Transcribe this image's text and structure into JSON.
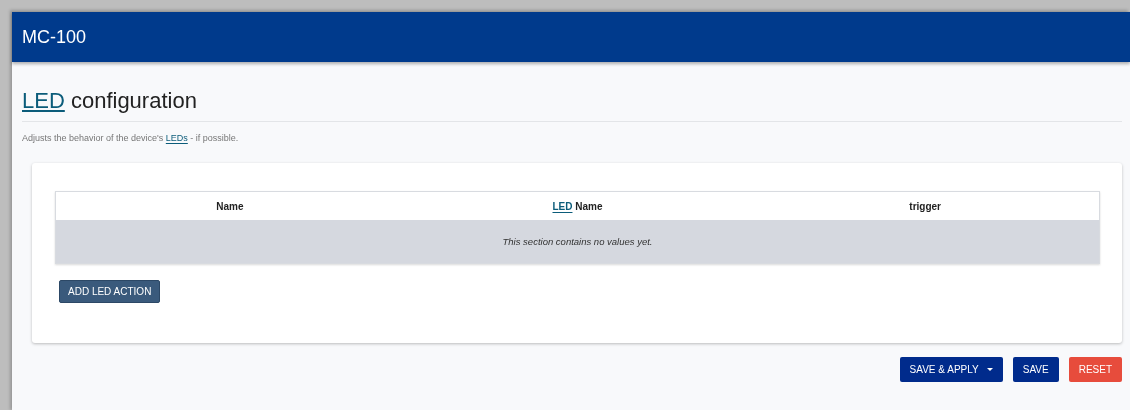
{
  "header": {
    "title": "MC-100"
  },
  "page": {
    "heading": [
      {
        "kind": "abbr",
        "text": "LED"
      },
      {
        "kind": "text",
        "text": " configuration"
      }
    ],
    "description": [
      {
        "kind": "text",
        "text": "Adjusts the behavior of the device's "
      },
      {
        "kind": "abbr",
        "text": "LEDs"
      },
      {
        "kind": "text",
        "text": " - if possible."
      }
    ]
  },
  "table": {
    "columns": [
      [
        {
          "kind": "text",
          "text": "Name"
        }
      ],
      [
        {
          "kind": "abbr",
          "text": "LED"
        },
        {
          "kind": "text",
          "text": " Name"
        }
      ],
      [
        {
          "kind": "text",
          "text": "trigger"
        }
      ]
    ],
    "empty_message": "This section contains no values yet."
  },
  "add_button": "ADD LED ACTION",
  "footer_buttons": [
    {
      "kind": "dropdown",
      "label": "SAVE & APPLY"
    },
    {
      "kind": "primary",
      "label": "SAVE"
    },
    {
      "kind": "danger",
      "label": "RESET"
    }
  ]
}
